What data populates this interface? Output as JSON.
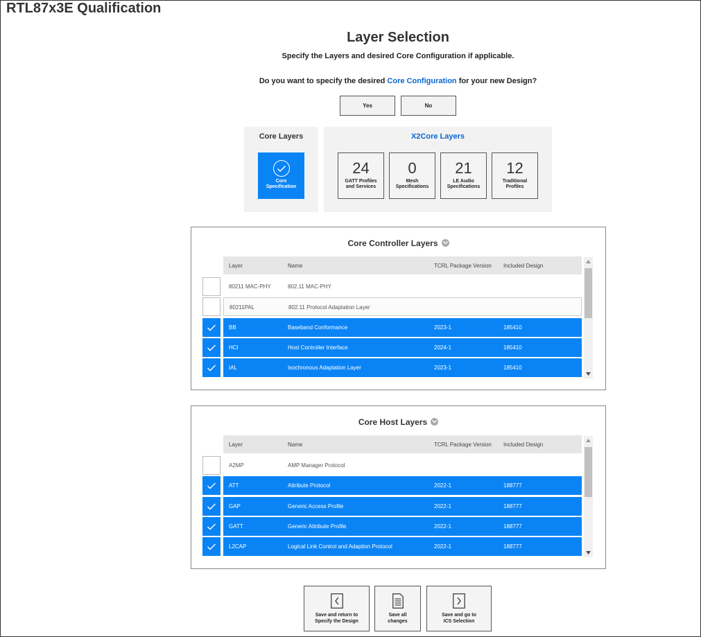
{
  "app_title": "RTL87x3E Qualification",
  "page": {
    "title": "Layer Selection",
    "subtitle": "Specify the Layers and desired Core Configuration if applicable.",
    "question_prefix": "Do you want to specify the desired",
    "question_link": "Core Configuration",
    "question_suffix": "for your new Design?",
    "yes_label": "Yes",
    "no_label": "No"
  },
  "core_layers": {
    "heading": "Core Layers",
    "tile_label_1": "Core",
    "tile_label_2": "Specification",
    "accent_color": "#0a84f5"
  },
  "x2core_layers": {
    "heading": "X2Core Layers",
    "tiles": [
      {
        "count": "24",
        "label_1": "GATT Profiles",
        "label_2": "and Services"
      },
      {
        "count": "0",
        "label_1": "Mesh",
        "label_2": "Specifications"
      },
      {
        "count": "21",
        "label_1": "LE Audio",
        "label_2": "Specifications"
      },
      {
        "count": "12",
        "label_1": "Traditional",
        "label_2": "Profiles"
      }
    ]
  },
  "columns": {
    "layer": "Layer",
    "name": "Name",
    "version": "TCRL Package Version",
    "included": "Included Design"
  },
  "controller": {
    "title": "Core Controller Layers",
    "rows": [
      {
        "layer": "80211 MAC-PHY",
        "name": "802.11 MAC-PHY",
        "version": "",
        "included": "",
        "selected": false
      },
      {
        "layer": "80211PAL",
        "name": "802.11 Protocol Adaptation Layer",
        "version": "",
        "included": "",
        "selected": false
      },
      {
        "layer": "BB",
        "name": "Baseband Conformance",
        "version": "2023-1",
        "included": "185410",
        "selected": true
      },
      {
        "layer": "HCI",
        "name": "Host Controller Interface",
        "version": "2024-1",
        "included": "185410",
        "selected": true
      },
      {
        "layer": "IAL",
        "name": "Isochronous Adaptation Layer",
        "version": "2023-1",
        "included": "185410",
        "selected": true
      }
    ]
  },
  "host": {
    "title": "Core Host Layers",
    "rows": [
      {
        "layer": "A2MP",
        "name": "AMP Manager Protocol",
        "version": "",
        "included": "",
        "selected": false
      },
      {
        "layer": "ATT",
        "name": "Attribute Protocol",
        "version": "2022-1",
        "included": "188777",
        "selected": true
      },
      {
        "layer": "GAP",
        "name": "Generic Access Profile",
        "version": "2022-1",
        "included": "188777",
        "selected": true
      },
      {
        "layer": "GATT",
        "name": "Generic Attribute Profile",
        "version": "2022-1",
        "included": "188777",
        "selected": true
      },
      {
        "layer": "L2CAP",
        "name": "Logical Link Control and Adaption Protocol",
        "version": "2022-1",
        "included": "188777",
        "selected": true
      }
    ]
  },
  "actions": {
    "save_return_1": "Save and return to",
    "save_return_2": "Specify the Design",
    "save_all_1": "Save all",
    "save_all_2": "changes",
    "save_ics_1": "Save and go to",
    "save_ics_2": "ICS Selection"
  }
}
